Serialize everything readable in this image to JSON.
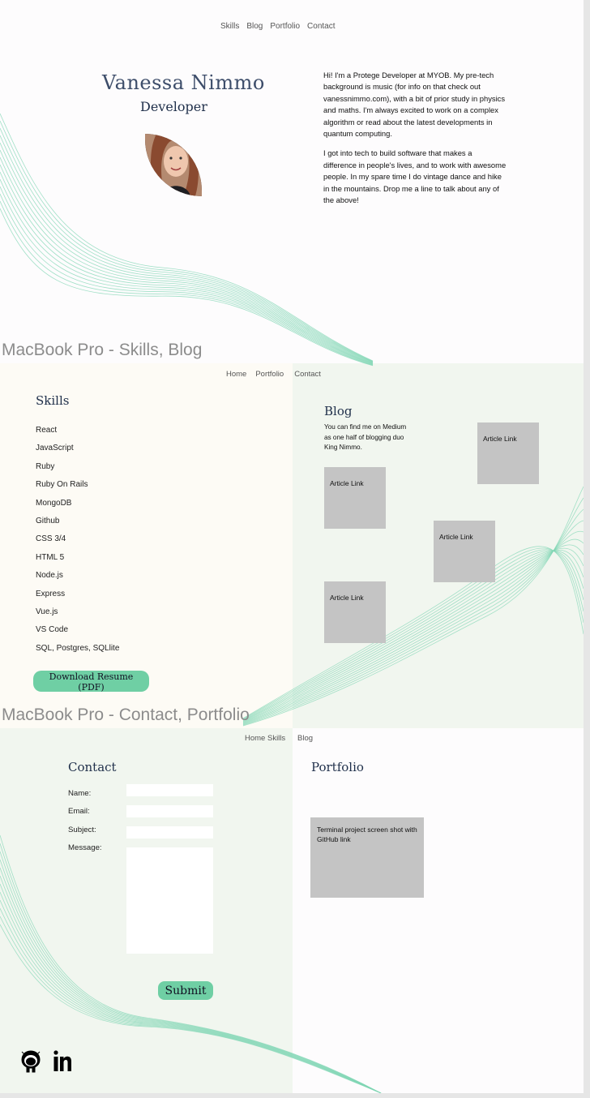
{
  "top_nav": [
    "Skills",
    "Blog",
    "Portfolio",
    "Contact"
  ],
  "hero": {
    "name": "Vanessa Nimmo",
    "role": "Developer",
    "bio": [
      "Hi! I'm a Protege Developer at MYOB. My pre-tech background is music (for info on that check out vanessnimmo.com), with a bit of prior study in physics and maths. I'm always excited to work on a complex algorithm or read about the latest developments in quantum computing.",
      "I got into tech to build software that makes a difference in people's lives, and to work with awesome people. In my spare time I do vintage dance and hike in the mountains. Drop me a line to talk about any of the above!"
    ]
  },
  "frames": {
    "skills_blog": "MacBook Pro - Skills, Blog",
    "contact_portfolio": "MacBook Pro - Contact, Portfolio"
  },
  "skills_nav": [
    "Home",
    "Portfolio",
    "Contact"
  ],
  "skills": {
    "heading": "Skills",
    "items": [
      "React",
      "JavaScript",
      "Ruby",
      "Ruby On Rails",
      "MongoDB",
      "Github",
      "CSS 3/4",
      "HTML 5",
      "Node.js",
      "Express",
      "Vue.js",
      "VS Code",
      "SQL, Postgres, SQLlite"
    ],
    "download_button": "Download Resume (PDF)"
  },
  "blog": {
    "heading": "Blog",
    "intro": "You can find me on Medium as one half of blogging duo King Nimmo.",
    "article_label": "Article Link"
  },
  "contact_nav": {
    "left": "Home Skills",
    "right": "Blog"
  },
  "contact": {
    "heading": "Contact",
    "labels": {
      "name": "Name:",
      "email": "Email:",
      "subject": "Subject:",
      "message": "Message:"
    },
    "submit": "Submit"
  },
  "portfolio": {
    "heading": "Portfolio",
    "card_text": "Terminal project screen shot with GitHub link"
  },
  "social_icons": [
    "github-icon",
    "linkedin-icon"
  ],
  "colors": {
    "accent_green": "#6fcfa4",
    "panel_cream": "#fdfbf5",
    "panel_mint": "#f1f6ef",
    "card_gray": "#c4c4c4",
    "heading_navy": "#1f2f4a"
  }
}
